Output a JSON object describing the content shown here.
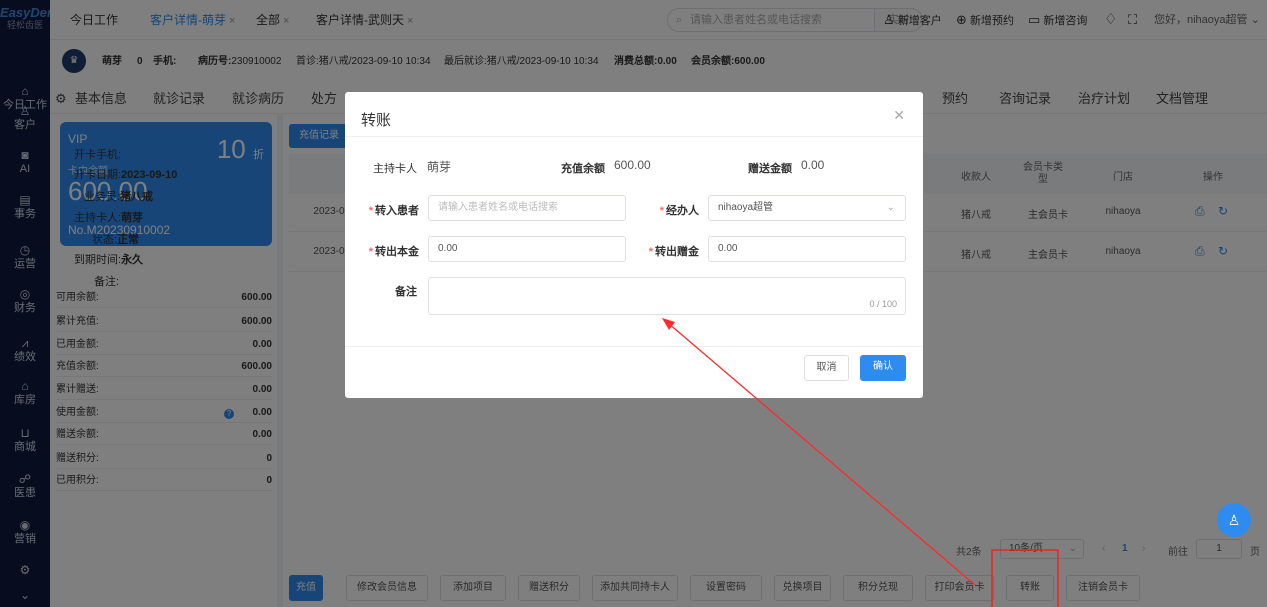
{
  "app": {
    "logo_text": "EasyDent",
    "logo_sub": "轻松齿医"
  },
  "sidebar": [
    {
      "label": "今日工作",
      "icon": "home-icon",
      "glyph": "⌂"
    },
    {
      "label": "客户",
      "icon": "user-icon",
      "glyph": "♙"
    },
    {
      "label": "AI",
      "icon": "ai-icon",
      "glyph": "◙"
    },
    {
      "label": "事务",
      "icon": "task-icon",
      "glyph": "▤"
    },
    {
      "label": "运营",
      "icon": "clock-icon",
      "glyph": "◷"
    },
    {
      "label": "财务",
      "icon": "finance-icon",
      "glyph": "◎"
    },
    {
      "label": "绩效",
      "icon": "chart-icon",
      "glyph": "⩘"
    },
    {
      "label": "库房",
      "icon": "warehouse-icon",
      "glyph": "⌂"
    },
    {
      "label": "商城",
      "icon": "cart-icon",
      "glyph": "⊔"
    },
    {
      "label": "医患",
      "icon": "people-icon",
      "glyph": "☍"
    },
    {
      "label": "营销",
      "icon": "marketing-icon",
      "glyph": "◉"
    },
    {
      "label": "",
      "icon": "settings-icon",
      "glyph": "⚙"
    },
    {
      "label": "",
      "icon": "collapse-icon",
      "glyph": "⌄"
    }
  ],
  "tabs": [
    {
      "label": "今日工作",
      "closable": false
    },
    {
      "label": "客户详情-萌芽",
      "closable": true
    },
    {
      "label": "全部",
      "closable": true
    },
    {
      "label": "客户详情-武则天",
      "closable": true
    }
  ],
  "topbar": {
    "search_placeholder": "请输入患者姓名或电话搜索",
    "search_btn": "实时",
    "new_customer": "新增客户",
    "new_appointment": "新增预约",
    "new_consult": "新增咨询",
    "greeting": "您好，nihaoya超管"
  },
  "patient": {
    "name": "萌芽",
    "age": "0",
    "phone_label": "手机:",
    "record_label": "病历号:",
    "record_no": "230910002",
    "first_visit": "首诊:猪八戒/2023-09-10 10:34",
    "last_visit": "最后就诊:猪八戒/2023-09-10 10:34",
    "total_consume": "消费总额:0.00",
    "member_balance": "会员余额:600.00"
  },
  "subtabs": [
    "基本信息",
    "就诊记录",
    "就诊病历",
    "处方",
    "预约",
    "咨询记录",
    "治疗计划",
    "文档管理"
  ],
  "card": {
    "level": "VIP",
    "discount": "10",
    "discount_unit": "折",
    "balance_label": "卡内余额",
    "balance": "600.00",
    "card_no": "No.M20230910002"
  },
  "card_info": [
    {
      "label": "开卡手机:",
      "value": ""
    },
    {
      "label": "开卡日期:",
      "value": "2023-09-10"
    },
    {
      "label": "业务员:",
      "value": "猪八戒"
    },
    {
      "label": "主持卡人:",
      "value": "萌芽"
    },
    {
      "label": "状态:",
      "value": "正常"
    },
    {
      "label": "到期时间:",
      "value": "永久"
    },
    {
      "label": "备注:",
      "value": ""
    }
  ],
  "stats": [
    {
      "label": "可用余额:",
      "value": "600.00"
    },
    {
      "label": "累计充值:",
      "value": "600.00"
    },
    {
      "label": "已用金额:",
      "value": "0.00"
    },
    {
      "label": "充值余额:",
      "value": "600.00"
    },
    {
      "label": "累计赠送:",
      "value": "0.00"
    },
    {
      "label": "使用金额:",
      "value": "0.00"
    },
    {
      "label": "赠送余额:",
      "value": "0.00"
    },
    {
      "label": "赠送积分:",
      "value": "0"
    },
    {
      "label": "已用积分:",
      "value": "0"
    }
  ],
  "records": {
    "tab_label": "充值记录",
    "columns": [
      "收款人",
      "会员卡类型",
      "门店",
      "操作"
    ],
    "rows": [
      {
        "date": "2023-0",
        "payee": "猪八戒",
        "type": "主会员卡",
        "store": "nihaoya"
      },
      {
        "date": "2023-0",
        "payee": "猪八戒",
        "type": "主会员卡",
        "store": "nihaoya"
      }
    ]
  },
  "pagination": {
    "total": "共2条",
    "page_size": "10条/页",
    "current": "1",
    "goto_label": "前往",
    "goto_value": "1",
    "page_unit": "页"
  },
  "actions": [
    "充值",
    "修改会员信息",
    "添加项目",
    "赠送积分",
    "添加共同持卡人",
    "设置密码",
    "兑换项目",
    "积分兑现",
    "打印会员卡",
    "转账",
    "注销会员卡"
  ],
  "modal": {
    "title": "转账",
    "holder_label": "主持卡人",
    "holder": "萌芽",
    "recharge_balance_label": "充值余额",
    "recharge_balance": "600.00",
    "gift_amount_label": "赠送金额",
    "gift_amount": "0.00",
    "target_label": "转入患者",
    "target_placeholder": "请输入患者姓名或电话搜索",
    "operator_label": "经办人",
    "operator": "nihaoya超管",
    "principal_label": "转出本金",
    "principal": "0.00",
    "gift_label": "转出赠金",
    "gift": "0.00",
    "remark_label": "备注",
    "remark_count": "0 / 100",
    "cancel": "取消",
    "confirm": "确认"
  }
}
